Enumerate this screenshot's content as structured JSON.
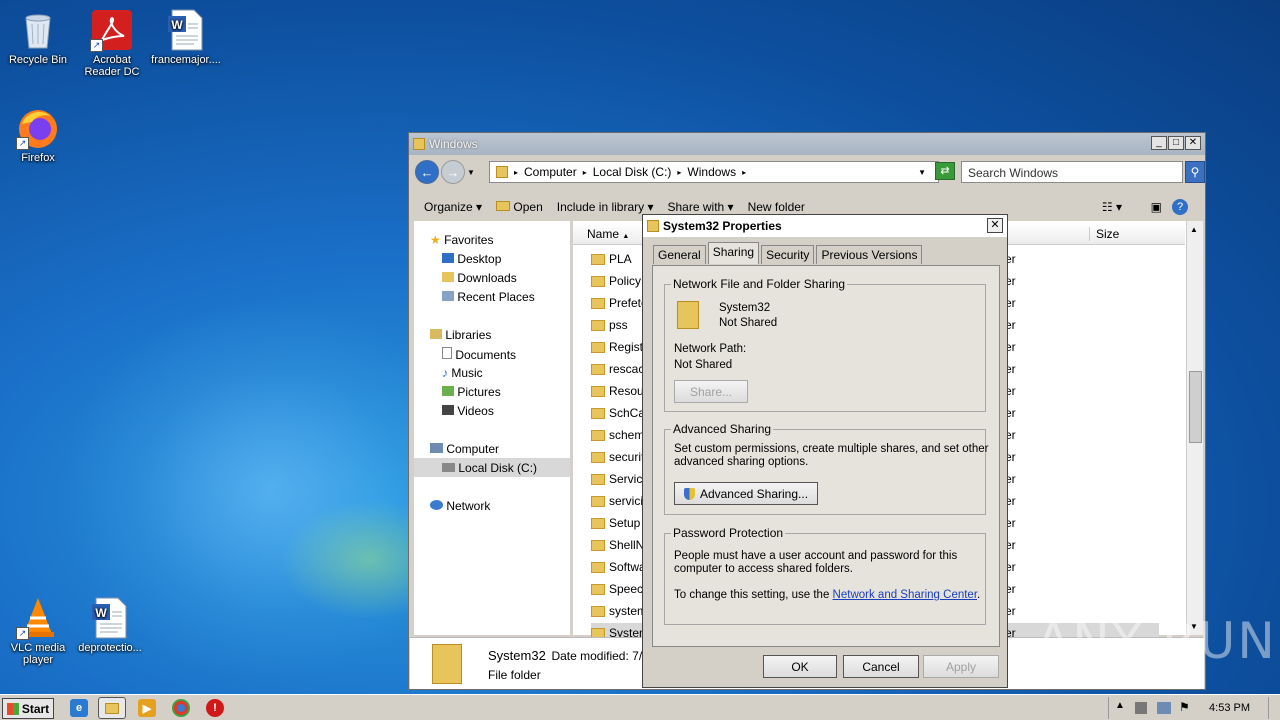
{
  "desktop": {
    "icons": [
      {
        "label": "Recycle Bin",
        "icon": "recycle-bin-icon"
      },
      {
        "label": "Acrobat Reader DC",
        "icon": "acrobat-icon"
      },
      {
        "label": "francemajor....",
        "icon": "word-doc-icon"
      },
      {
        "label": "Firefox",
        "icon": "firefox-icon"
      },
      {
        "label": "VLC media player",
        "icon": "vlc-icon"
      },
      {
        "label": "deprotectio...",
        "icon": "word-doc-icon"
      }
    ]
  },
  "explorer": {
    "title": "Windows",
    "breadcrumb": [
      "Computer",
      "Local Disk (C:)",
      "Windows"
    ],
    "search_placeholder": "Search Windows",
    "toolbar": {
      "organize": "Organize",
      "open": "Open",
      "include": "Include in library",
      "share": "Share with",
      "new_folder": "New folder"
    },
    "nav": {
      "favorites": "Favorites",
      "desktop": "Desktop",
      "downloads": "Downloads",
      "recent": "Recent Places",
      "libraries": "Libraries",
      "documents": "Documents",
      "music": "Music",
      "pictures": "Pictures",
      "videos": "Videos",
      "computer": "Computer",
      "local_disk": "Local Disk (C:)",
      "network": "Network"
    },
    "columns": {
      "name": "Name",
      "size": "Size"
    },
    "rows": [
      "PLA",
      "PolicyD",
      "Prefetc",
      "pss",
      "Registr",
      "rescacl",
      "Resour",
      "SchCac",
      "schema",
      "securit",
      "Service",
      "servicin",
      "Setup",
      "ShellNe",
      "Softwa",
      "Speech",
      "system",
      "System"
    ],
    "row_type_suffix": "er",
    "details": {
      "name": "System32",
      "modified_label": "Date modified: 7/1/",
      "type": "File folder"
    }
  },
  "dialog": {
    "title": "System32 Properties",
    "close": "✕",
    "tabs": [
      "General",
      "Sharing",
      "Security",
      "Previous Versions"
    ],
    "active_tab": "Sharing",
    "network_sharing": {
      "group": "Network File and Folder Sharing",
      "folder_name": "System32",
      "status": "Not Shared",
      "path_label": "Network Path:",
      "path_value": "Not Shared",
      "share_button": "Share..."
    },
    "advanced_sharing": {
      "group": "Advanced Sharing",
      "description_1": "Set custom permissions, create multiple shares, and set other",
      "description_2": "advanced sharing options.",
      "button": "Advanced Sharing..."
    },
    "password": {
      "group": "Password Protection",
      "line1": "People must have a user account and password for this",
      "line2": "computer to access shared folders.",
      "line3_prefix": "To change this setting, use the ",
      "link": "Network and Sharing Center",
      "line3_suffix": "."
    },
    "buttons": {
      "ok": "OK",
      "cancel": "Cancel",
      "apply": "Apply"
    }
  },
  "taskbar": {
    "start": "Start",
    "clock": "4:53 PM"
  },
  "watermark": "ANY RUN"
}
